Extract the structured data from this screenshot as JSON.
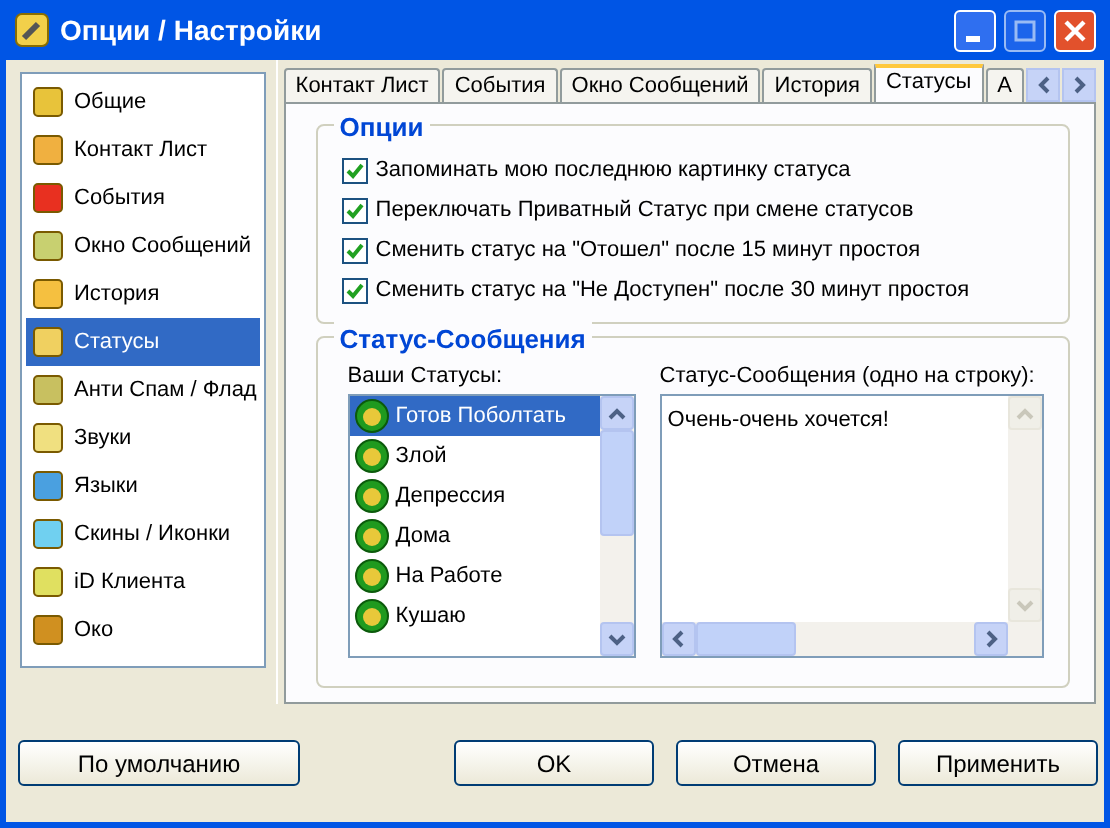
{
  "window": {
    "title": "Опции / Настройки"
  },
  "sidebar": {
    "items": [
      {
        "label": "Общие",
        "selected": false
      },
      {
        "label": "Контакт Лист",
        "selected": false
      },
      {
        "label": "События",
        "selected": false
      },
      {
        "label": "Окно Сообщений",
        "selected": false
      },
      {
        "label": "История",
        "selected": false
      },
      {
        "label": "Статусы",
        "selected": true
      },
      {
        "label": "Анти Спам / Флад",
        "selected": false
      },
      {
        "label": "Звуки",
        "selected": false
      },
      {
        "label": "Языки",
        "selected": false
      },
      {
        "label": "Скины / Иконки",
        "selected": false
      },
      {
        "label": "iD Клиента",
        "selected": false
      },
      {
        "label": "Око",
        "selected": false
      }
    ]
  },
  "tabs": [
    {
      "label": "Контакт Лист",
      "selected": false
    },
    {
      "label": "События",
      "selected": false
    },
    {
      "label": "Окно Сообщений",
      "selected": false
    },
    {
      "label": "История",
      "selected": false
    },
    {
      "label": "Статусы",
      "selected": true
    },
    {
      "label": "А",
      "selected": false
    }
  ],
  "options_group": {
    "title": "Опции",
    "checkboxes": [
      {
        "label": "Запоминать мою последнюю картинку статуса",
        "checked": true
      },
      {
        "label": "Переключать Приватный Статус при смене статусов",
        "checked": true
      },
      {
        "label": "Сменить статус на \"Отошел\" после 15 минут простоя",
        "checked": true
      },
      {
        "label": "Сменить статус на \"Не Доступен\" после 30 минут простоя",
        "checked": true
      }
    ]
  },
  "status_messages_group": {
    "title": "Статус-Сообщения",
    "statuses_label": "Ваши Статусы:",
    "statuses": [
      {
        "label": "Готов Поболтать",
        "selected": true
      },
      {
        "label": "Злой",
        "selected": false
      },
      {
        "label": "Депрессия",
        "selected": false
      },
      {
        "label": "Дома",
        "selected": false
      },
      {
        "label": "На Работе",
        "selected": false
      },
      {
        "label": "Кушаю",
        "selected": false
      }
    ],
    "messages_label": "Статус-Сообщения (одно на строку):",
    "messages_text": "Очень-очень хочется!"
  },
  "buttons": {
    "defaults": "По умолчанию",
    "ok": "OK",
    "cancel": "Отмена",
    "apply": "Применить"
  }
}
